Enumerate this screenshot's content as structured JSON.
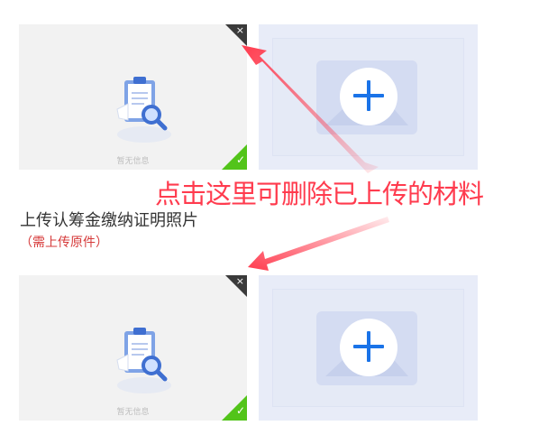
{
  "upload_groups": [
    {
      "status_text": "暂无信息",
      "delete_symbol": "×",
      "success_symbol": "✓"
    },
    {
      "status_text": "暂无信息",
      "delete_symbol": "×",
      "success_symbol": "✓"
    }
  ],
  "section": {
    "title": "上传认筹金缴纳证明照片",
    "note": "（需上传原件）"
  },
  "annotation": {
    "text": "点击这里可删除已上传的材料",
    "color": "#ff3b4e"
  },
  "colors": {
    "success": "#52c41a",
    "delete_corner": "#3a3a3a",
    "add_plus": "#1a73e8",
    "add_bg": "#e8ecf8"
  },
  "icons": [
    "document-search-icon",
    "close-icon",
    "check-icon",
    "add-image-icon",
    "plus-icon",
    "arrow-icon"
  ]
}
